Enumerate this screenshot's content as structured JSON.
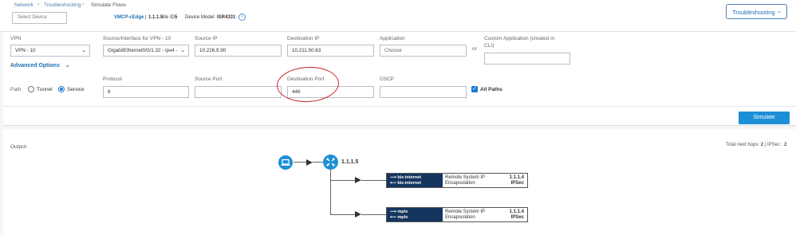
{
  "breadcrumb": {
    "items": [
      "Network",
      "Troubleshooting",
      "Simulate Flows"
    ],
    "separator": "›"
  },
  "device_select": {
    "placeholder": "Select Device"
  },
  "device_info": {
    "name": "VMCP-cEdge",
    "system_ip": "1.1.1.5",
    "site_label": "Site ID:",
    "site_id": "5",
    "model_label": "Device Model:",
    "model": "ISR4331"
  },
  "header_button": {
    "label": "Troubleshooting",
    "icon": "chevron-down-icon"
  },
  "form": {
    "vpn": {
      "label": "VPN",
      "value": "VPN - 10"
    },
    "source_interface": {
      "label": "Source/Interface for VPN - 10",
      "value": "GigabitEthernet0/0/1.32 - ipv4 -"
    },
    "source_ip": {
      "label": "Source IP",
      "value": "10.226.9.90"
    },
    "destination_ip": {
      "label": "Destination IP",
      "value": "10.211.50.63"
    },
    "application": {
      "label": "Application",
      "placeholder": "Choose"
    },
    "or_text": "or",
    "custom_application": {
      "label_line1": "Custom Application (created in",
      "label_line2": "CLI)",
      "value": ""
    },
    "advanced_options": "Advanced Options",
    "path": {
      "label": "Path",
      "options": [
        {
          "label": "Tunnel",
          "selected": false
        },
        {
          "label": "Service",
          "selected": true
        }
      ]
    },
    "protocol": {
      "label": "Protocol",
      "value": "6"
    },
    "source_port": {
      "label": "Source Port",
      "value": ""
    },
    "destination_port": {
      "label": "Destination Port",
      "value": "446"
    },
    "dscp": {
      "label": "DSCP",
      "value": ""
    },
    "all_paths": {
      "label": "All Paths",
      "checked": true
    }
  },
  "simulate_button": {
    "label": "Simulate"
  },
  "output": {
    "label": "Output:",
    "summary_prefix": "Total next hops:",
    "total_next_hops": "2",
    "summary_mid": "| IPSec :",
    "ipsec_count": "2",
    "node_label": "1.1.1.5",
    "hops": [
      {
        "tunnel_out": "⟶ biz-internet",
        "tunnel_in": "⟵ biz-internet",
        "remote_label": "Remote System IP",
        "remote_value": "1.1.1.4",
        "enc_label": "Encapsulation",
        "enc_value": "IPSec"
      },
      {
        "tunnel_out": "⟶ mpls",
        "tunnel_in": "⟵ mpls",
        "remote_label": "Remote System IP",
        "remote_value": "1.1.1.4",
        "enc_label": "Encapsulation",
        "enc_value": "IPSec"
      }
    ]
  },
  "colors": {
    "accent": "#1d8fd6",
    "link": "#1d6fb5",
    "tunnel_bg": "#14365e",
    "annotation": "#c62828"
  }
}
